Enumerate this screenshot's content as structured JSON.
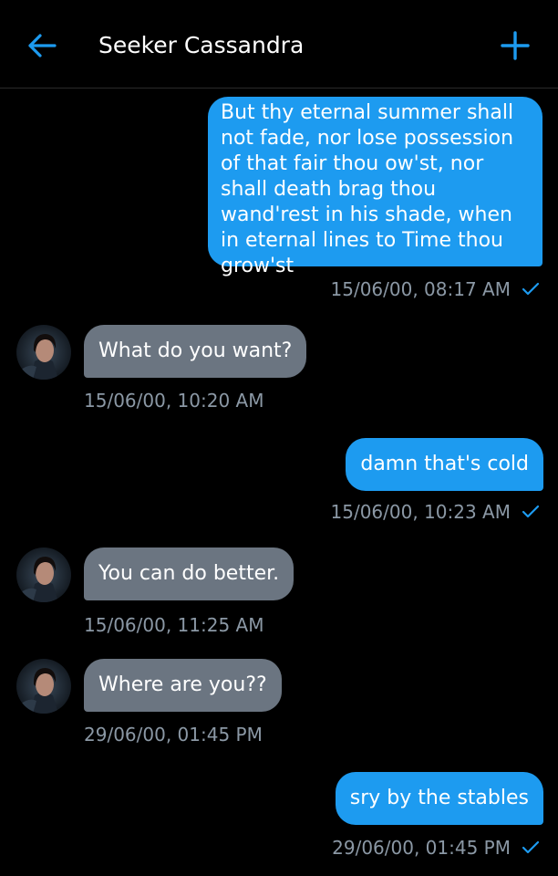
{
  "header": {
    "title": "Seeker Cassandra",
    "back_icon": "arrow-left-icon",
    "add_icon": "plus-icon",
    "accent": "#1d9bf0"
  },
  "colors": {
    "outgoing_bubble": "#1d9bf0",
    "incoming_bubble": "#6b7581",
    "timestamp": "#8b98a5",
    "background": "#000000"
  },
  "messages": [
    {
      "direction": "outgoing",
      "text": "But thy eternal summer shall not fade, nor lose possession of that fair thou ow'st, nor shall death brag thou wand'rest in his shade, when in eternal lines to Time thou grow'st",
      "timestamp": "15/06/00, 08:17 AM",
      "read": true
    },
    {
      "direction": "incoming",
      "text": "What do you want?",
      "timestamp": "15/06/00, 10:20 AM"
    },
    {
      "direction": "outgoing",
      "text": "damn that's cold",
      "timestamp": "15/06/00, 10:23 AM",
      "read": true
    },
    {
      "direction": "incoming",
      "text": "You can do better.",
      "timestamp": "15/06/00, 11:25 AM"
    },
    {
      "direction": "incoming",
      "text": "Where are you??",
      "timestamp": "29/06/00, 01:45 PM"
    },
    {
      "direction": "outgoing",
      "text": "sry by the stables",
      "timestamp": "29/06/00, 01:45 PM",
      "read": true
    }
  ]
}
